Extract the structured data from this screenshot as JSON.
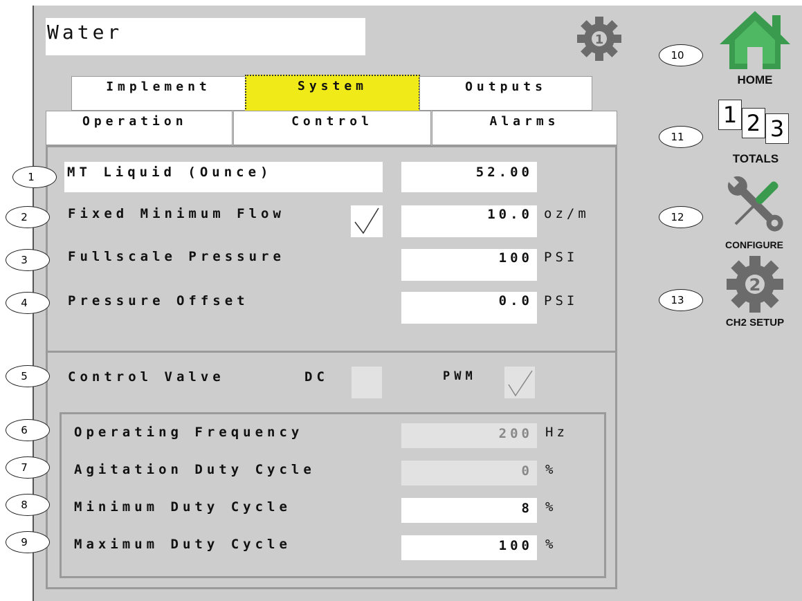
{
  "screen": {
    "title": "Water",
    "settings_icon_number": "1"
  },
  "tabs_row1": [
    "Implement",
    "System",
    "Outputs"
  ],
  "tabs_row1_selected": "System",
  "tabs_row2": [
    "Operation",
    "Control",
    "Alarms"
  ],
  "settings": [
    {
      "label": "MT Liquid (Ounce)",
      "value": "52.00",
      "unit": ""
    },
    {
      "label": "Fixed Minimum Flow",
      "value": "10.0",
      "unit": "oz/m",
      "checked": true
    },
    {
      "label": "Fullscale Pressure",
      "value": "100",
      "unit": "PSI"
    },
    {
      "label": "Pressure Offset",
      "value": "0.0",
      "unit": "PSI"
    }
  ],
  "control_valve": {
    "label": "Control Valve",
    "dc_label": "DC",
    "dc_checked": false,
    "pwm_label": "PWM",
    "pwm_checked": true
  },
  "pwm_settings": [
    {
      "label": "Operating Frequency",
      "value": "200",
      "unit": "Hz",
      "enabled": false
    },
    {
      "label": "Agitation Duty Cycle",
      "value": "0",
      "unit": "%",
      "enabled": false
    },
    {
      "label": "Minimum Duty Cycle",
      "value": "8",
      "unit": "%",
      "enabled": true
    },
    {
      "label": "Maximum Duty Cycle",
      "value": "100",
      "unit": "%",
      "enabled": true
    }
  ],
  "nav": {
    "home_label": "HOME",
    "totals_label": "TOTALS",
    "totals_digits": [
      "1",
      "2",
      "3"
    ],
    "configure_label": "CONFIGURE",
    "ch2_label": "CH2 SETUP",
    "ch2_icon_number": "2"
  },
  "callouts": [
    "1",
    "2",
    "3",
    "4",
    "5",
    "6",
    "7",
    "8",
    "9",
    "10",
    "11",
    "12",
    "13"
  ],
  "colors": {
    "selected_tab": "#f0ea18",
    "home_green": "#3a9a4e",
    "icon_gray": "#6b6b6b"
  }
}
